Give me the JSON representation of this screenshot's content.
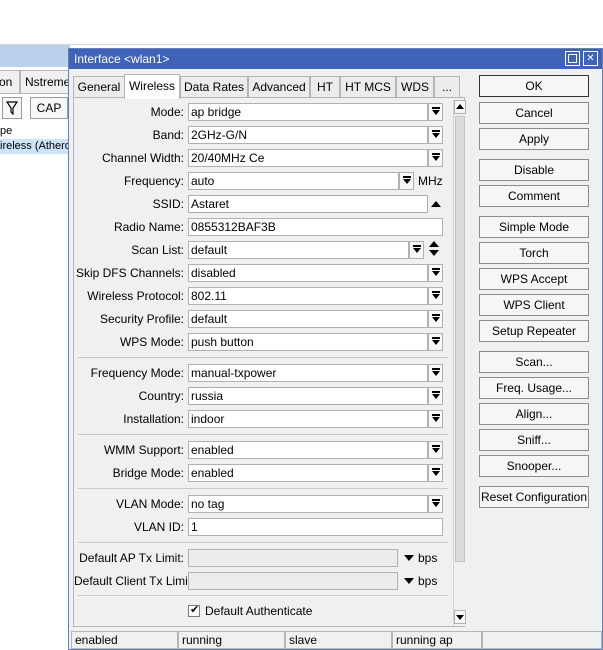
{
  "background_window": {
    "tabs": [
      "on",
      "Nstreme"
    ],
    "toolbar": {
      "cap_label": "CAP"
    },
    "header": "pe",
    "row_text": "ireless (Atheros"
  },
  "dialog": {
    "title": "Interface <wlan1>",
    "tabs": [
      "General",
      "Wireless",
      "Data Rates",
      "Advanced",
      "HT",
      "HT MCS",
      "WDS",
      "..."
    ],
    "active_tab": "Wireless",
    "fields": {
      "mode": {
        "label": "Mode:",
        "value": "ap bridge"
      },
      "band": {
        "label": "Band:",
        "value": "2GHz-G/N"
      },
      "channel_width": {
        "label": "Channel Width:",
        "value": "20/40MHz Ce"
      },
      "frequency": {
        "label": "Frequency:",
        "value": "auto",
        "unit": "MHz"
      },
      "ssid": {
        "label": "SSID:",
        "value": "Astaret"
      },
      "radio_name": {
        "label": "Radio Name:",
        "value": "0855312BAF3B"
      },
      "scan_list": {
        "label": "Scan List:",
        "value": "default"
      },
      "skip_dfs": {
        "label": "Skip DFS Channels:",
        "value": "disabled"
      },
      "wireless_protocol": {
        "label": "Wireless Protocol:",
        "value": "802.11"
      },
      "security_profile": {
        "label": "Security Profile:",
        "value": "default"
      },
      "wps_mode": {
        "label": "WPS Mode:",
        "value": "push button"
      },
      "frequency_mode": {
        "label": "Frequency Mode:",
        "value": "manual-txpower"
      },
      "country": {
        "label": "Country:",
        "value": "russia"
      },
      "installation": {
        "label": "Installation:",
        "value": "indoor"
      },
      "wmm_support": {
        "label": "WMM Support:",
        "value": "enabled"
      },
      "bridge_mode": {
        "label": "Bridge Mode:",
        "value": "enabled"
      },
      "vlan_mode": {
        "label": "VLAN Mode:",
        "value": "no tag"
      },
      "vlan_id": {
        "label": "VLAN ID:",
        "value": "1"
      },
      "default_ap_tx_limit": {
        "label": "Default AP Tx Limit:",
        "value": "",
        "unit": "bps"
      },
      "default_client_tx_limit": {
        "label": "Default Client Tx Limit:",
        "value": "",
        "unit": "bps"
      },
      "default_authenticate": {
        "label": "Default Authenticate",
        "checked": true
      }
    },
    "buttons": {
      "ok": "OK",
      "cancel": "Cancel",
      "apply": "Apply",
      "disable": "Disable",
      "comment": "Comment",
      "simple_mode": "Simple Mode",
      "torch": "Torch",
      "wps_accept": "WPS Accept",
      "wps_client": "WPS Client",
      "setup_repeater": "Setup Repeater",
      "scan": "Scan...",
      "freq_usage": "Freq. Usage...",
      "align": "Align...",
      "sniff": "Sniff...",
      "snooper": "Snooper...",
      "reset_configuration": "Reset Configuration"
    },
    "status": [
      "enabled",
      "running",
      "slave",
      "running ap",
      ""
    ]
  },
  "colors": {
    "titlebar": "#3e63b8",
    "selection": "#cde3f7"
  }
}
